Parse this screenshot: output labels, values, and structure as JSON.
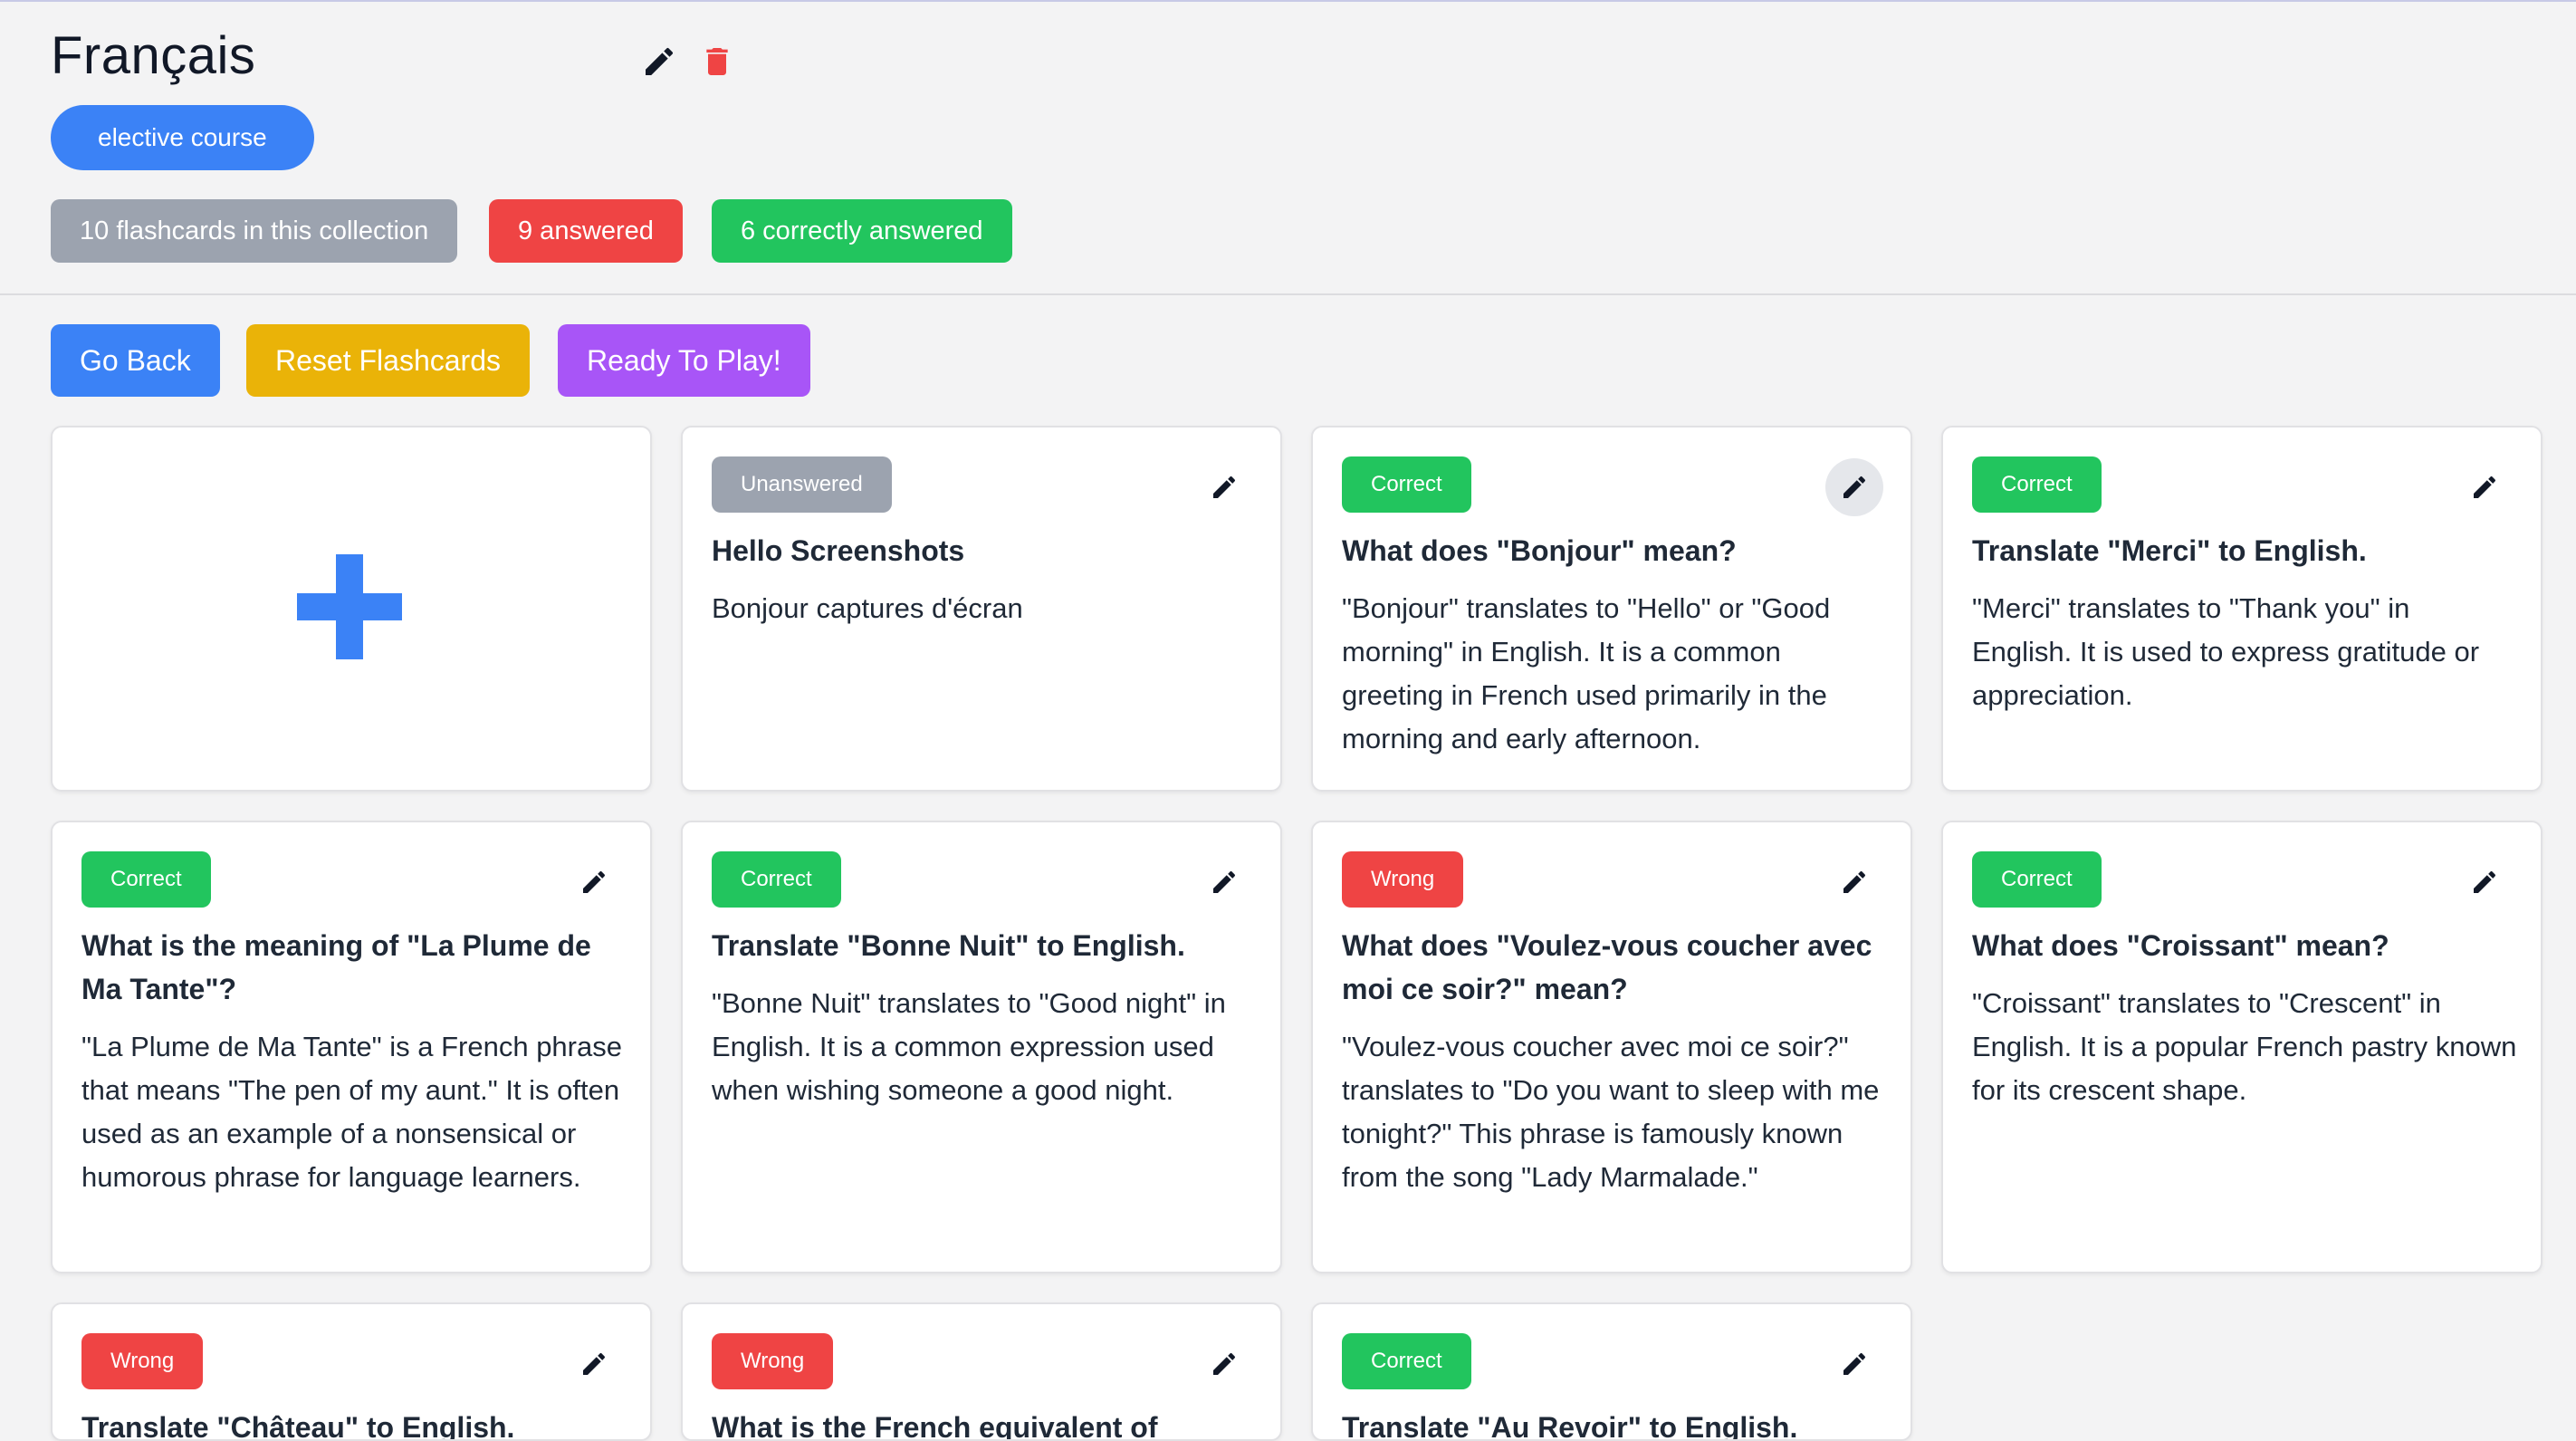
{
  "collection": {
    "title": "Français",
    "edit_icon": "pencil-icon",
    "delete_icon": "trash-icon",
    "tag": "elective course",
    "stats": {
      "total": "10 flashcards in this collection",
      "answered": "9 answered",
      "correct": "6 correctly answered"
    }
  },
  "actions": {
    "back": "Go Back",
    "reset": "Reset Flashcards",
    "play": "Ready To Play!"
  },
  "colors": {
    "blue": "#3b82f6",
    "green": "#22c55e",
    "red": "#ef4444",
    "gray": "#9ca3af",
    "yellow": "#eab308",
    "purple": "#a855f7"
  },
  "cards": [
    {
      "status": "Unanswered",
      "question": "Hello Screenshots",
      "answer": "Bonjour captures d'écran"
    },
    {
      "status": "Correct",
      "question": "What does \"Bonjour\" mean?",
      "answer": "\"Bonjour\" translates to \"Hello\" or \"Good morning\" in English. It is a common greeting in French used primarily in the morning and early afternoon."
    },
    {
      "status": "Correct",
      "question": "Translate \"Merci\" to English.",
      "answer": "\"Merci\" translates to \"Thank you\" in English. It is used to express gratitude or appreciation."
    },
    {
      "status": "Correct",
      "question": "What is the meaning of \"La Plume de Ma Tante\"?",
      "answer": "\"La Plume de Ma Tante\" is a French phrase that means \"The pen of my aunt.\" It is often used as an example of a nonsensical or humorous phrase for language learners."
    },
    {
      "status": "Correct",
      "question": "Translate \"Bonne Nuit\" to English.",
      "answer": "\"Bonne Nuit\" translates to \"Good night\" in English. It is a common expression used when wishing someone a good night."
    },
    {
      "status": "Wrong",
      "question": "What does \"Voulez-vous coucher avec moi ce soir?\" mean?",
      "answer": "\"Voulez-vous coucher avec moi ce soir?\" translates to \"Do you want to sleep with me tonight?\" This phrase is famously known from the song \"Lady Marmalade.\""
    },
    {
      "status": "Correct",
      "question": "What does \"Croissant\" mean?",
      "answer": "\"Croissant\" translates to \"Crescent\" in English. It is a popular French pastry known for its crescent shape."
    },
    {
      "status": "Wrong",
      "question": "Translate \"Château\" to English.",
      "answer": ""
    },
    {
      "status": "Wrong",
      "question": "What is the French equivalent of",
      "answer": ""
    },
    {
      "status": "Correct",
      "question": "Translate \"Au Revoir\" to English.",
      "answer": ""
    }
  ]
}
